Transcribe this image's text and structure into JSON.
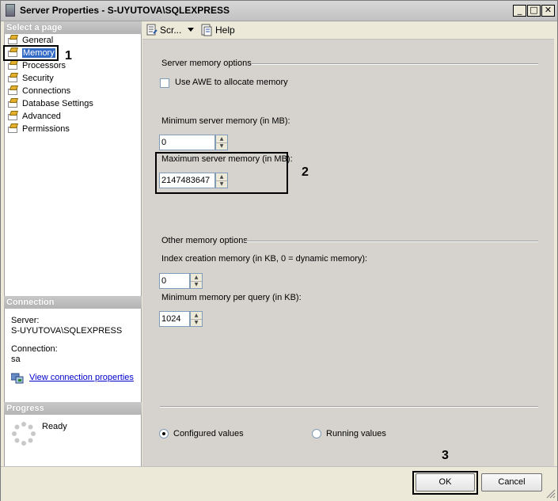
{
  "window": {
    "title": "Server Properties - S-UYUTOVA\\SQLEXPRESS"
  },
  "titlebar_buttons": {
    "minimize": "_",
    "maximize": "□",
    "close": "✕"
  },
  "left_pane": {
    "header": "Select a page",
    "items": [
      {
        "label": "General",
        "selected": false
      },
      {
        "label": "Memory",
        "selected": true
      },
      {
        "label": "Processors",
        "selected": false
      },
      {
        "label": "Security",
        "selected": false
      },
      {
        "label": "Connections",
        "selected": false
      },
      {
        "label": "Database Settings",
        "selected": false
      },
      {
        "label": "Advanced",
        "selected": false
      },
      {
        "label": "Permissions",
        "selected": false
      }
    ],
    "connection": {
      "header": "Connection",
      "server_label": "Server:",
      "server_value": "S-UYUTOVA\\SQLEXPRESS",
      "connection_label": "Connection:",
      "connection_value": "sa",
      "view_link": "View connection properties"
    },
    "progress": {
      "header": "Progress",
      "status": "Ready"
    }
  },
  "toolbar": {
    "script_label": "Scr...",
    "help_label": "Help"
  },
  "memory": {
    "server_options_title": "Server memory options",
    "awe_label": "Use AWE to allocate memory",
    "awe_checked": false,
    "min_label": "Minimum server memory (in MB):",
    "min_value": "0",
    "max_label": "Maximum server memory (in MB):",
    "max_value": "2147483647",
    "other_options_title": "Other memory options",
    "index_label": "Index creation memory (in KB, 0 = dynamic memory):",
    "index_value": "0",
    "min_query_label": "Minimum memory per query (in KB):",
    "min_query_value": "1024",
    "configured_label": "Configured values",
    "running_label": "Running values",
    "configured_selected": true
  },
  "callouts": {
    "one": "1",
    "two": "2",
    "three": "3"
  },
  "buttons": {
    "ok": "OK",
    "cancel": "Cancel"
  },
  "colors": {
    "selection": "#316ac5",
    "link": "#0000cc",
    "content_bg": "#d6d3ce"
  }
}
